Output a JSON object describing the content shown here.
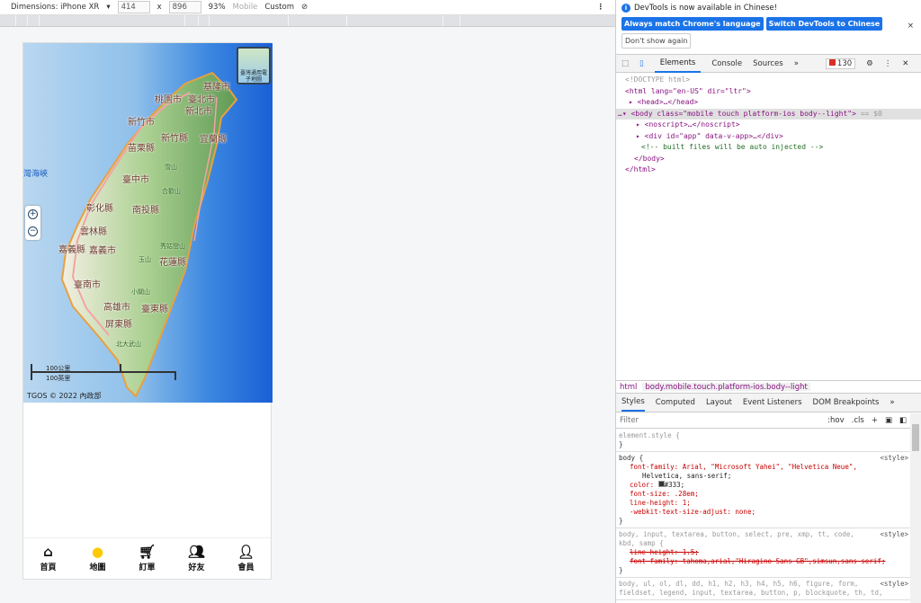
{
  "device_toolbar": {
    "dimensions_label": "Dimensions: iPhone XR",
    "width": "414",
    "x": "x",
    "height": "896",
    "zoom": "93%",
    "mode": "Mobile",
    "throttle": "Custom"
  },
  "map": {
    "sea_label": "灣海峽",
    "layer_button": "臺灣通用電子地圖",
    "zoom_in": "+",
    "zoom_out": "−",
    "places": [
      "基隆市",
      "桃園市",
      "臺北市",
      "新北市",
      "新竹市",
      "新竹縣",
      "宜蘭縣",
      "苗栗縣",
      "臺中市",
      "彰化縣",
      "南投縣",
      "雲林縣",
      "嘉義縣",
      "嘉義市",
      "花蓮縣",
      "臺南市",
      "高雄市",
      "臺東縣",
      "屏東縣",
      "花"
    ],
    "mountains": [
      "雪山",
      "合歡山",
      "秀姑巒山",
      "玉山",
      "小關山",
      "北大武山"
    ],
    "scale_km": "100公里",
    "scale_mi": "100英里",
    "copyright": "TGOS © 2022 內政部"
  },
  "bottom_nav": [
    {
      "label": "首頁",
      "icon": "home-icon"
    },
    {
      "label": "地圖",
      "icon": "map-pin-icon"
    },
    {
      "label": "訂單",
      "icon": "cart-icon"
    },
    {
      "label": "好友",
      "icon": "friends-icon"
    },
    {
      "label": "會員",
      "icon": "member-icon"
    }
  ],
  "colors": {
    "active_nav": "#ffc800",
    "devtools_blue": "#1a73e8"
  },
  "devtools": {
    "info_message": "DevTools is now available in Chinese!",
    "btn_match": "Always match Chrome's language",
    "btn_switch": "Switch DevTools to Chinese",
    "btn_dont_show": "Don't show again",
    "tabs": [
      "Elements",
      "Console",
      "Sources",
      "»"
    ],
    "error_count": "130",
    "dom": {
      "doctype": "<!DOCTYPE html>",
      "html_open": "<html lang=\"en-US\" dir=\"ltr\">",
      "head": "<head>…</head>",
      "body_open": "<body class=\"mobile touch platform-ios body--light\">",
      "body_suffix": "== $0",
      "noscript": "<noscript>…</noscript>",
      "app": "<div id=\"app\" data-v-app>…</div>",
      "comment": "<!-- built files will be auto injected -->",
      "body_close": "</body>",
      "html_close": "</html>"
    },
    "breadcrumbs": [
      "html",
      "body.mobile.touch.platform-ios.body--light"
    ],
    "style_tabs": [
      "Styles",
      "Computed",
      "Layout",
      "Event Listeners",
      "DOM Breakpoints",
      "»"
    ],
    "filter_placeholder": "Filter",
    "hov": ":hov",
    "cls": ".cls",
    "rules": {
      "element_style": "element.style {",
      "close": "}",
      "body_sel": "body {",
      "src": "<style>",
      "ff": "font-family: Arial, \"Microsoft Yahei\", \"Helvetica Neue\",",
      "ff2": "Helvetica, sans-serif;",
      "color": "color:",
      "color_val": "#333;",
      "fs": "font-size: .28em;",
      "lh": "line-height: 1;",
      "ws": "-webkit-text-size-adjust: none;",
      "sel2": "body, input, textarea, button, select, pre, xmp, tt, code,",
      "sel2b": "kbd, samp {",
      "s1": "line-height: 1.5;",
      "s2": "font-family: tahoma,arial,\"Hiragino Sans GB\",simsun,sans-serif;",
      "sel3": "body, ul, ol, dl, dd, h1, h2, h3, h4, h5, h6, figure, form,",
      "sel3b": "fieldset, legend, input, textarea, button, p, blockquote, th, td,"
    }
  }
}
